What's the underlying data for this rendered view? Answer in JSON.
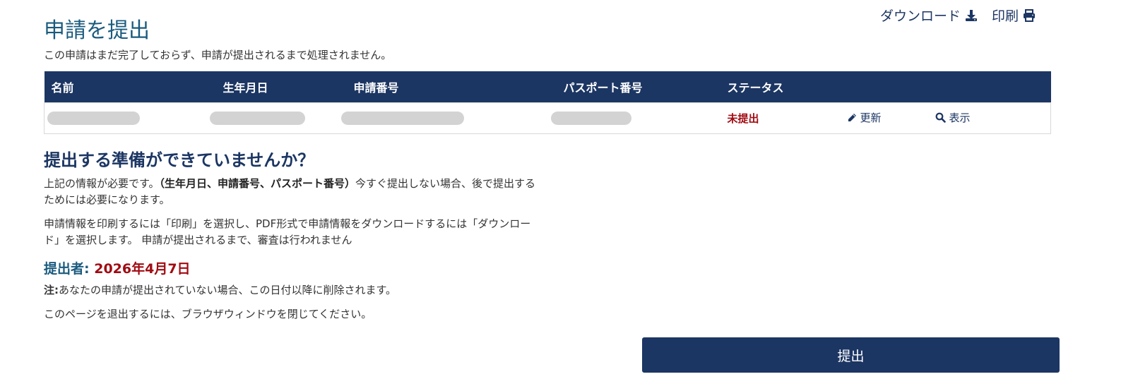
{
  "header": {
    "download_label": "ダウンロード",
    "print_label": "印刷"
  },
  "page": {
    "title": "申請を提出",
    "intro": "この申請はまだ完了しておらず、申請が提出されるまで処理されません。"
  },
  "table": {
    "columns": [
      "名前",
      "生年月日",
      "申請番号",
      "パスポート番号",
      "ステータス",
      "",
      ""
    ],
    "rows": [
      {
        "status": "未提出",
        "update_label": "更新",
        "view_label": "表示"
      }
    ]
  },
  "ready_section": {
    "heading": "提出する準備ができていませんか？",
    "para1_prefix": "上記の情報が必要です。",
    "para1_bold": "（生年月日、申請番号、パスポート番号）",
    "para1_suffix": "今すぐ提出しない場合、後で提出するためには必要になります。",
    "para2": "申請情報を印刷するには「印刷」を選択し、PDF形式で申請情報をダウンロードするには「ダウンロード」を選択します。 申請が提出されるまで、審査は行われません",
    "deadline_label": "提出者:",
    "deadline_date": "2026年4月7日",
    "note_label": "注:",
    "note_text": "あなたの申請が提出されていない場合、この日付以降に削除されます。",
    "exit_text": "このページを退出するには、ブラウザウィンドウを閉じてください。"
  },
  "submit_label": "提出",
  "colors": {
    "navy": "#1c3663",
    "teal_title": "#1b5b7e",
    "status_red": "#a10b12",
    "placeholder_gray": "#d3d3d3"
  },
  "icons": {
    "download": "download-icon",
    "print": "printer-icon",
    "update": "pencil-icon",
    "view": "search-icon"
  }
}
